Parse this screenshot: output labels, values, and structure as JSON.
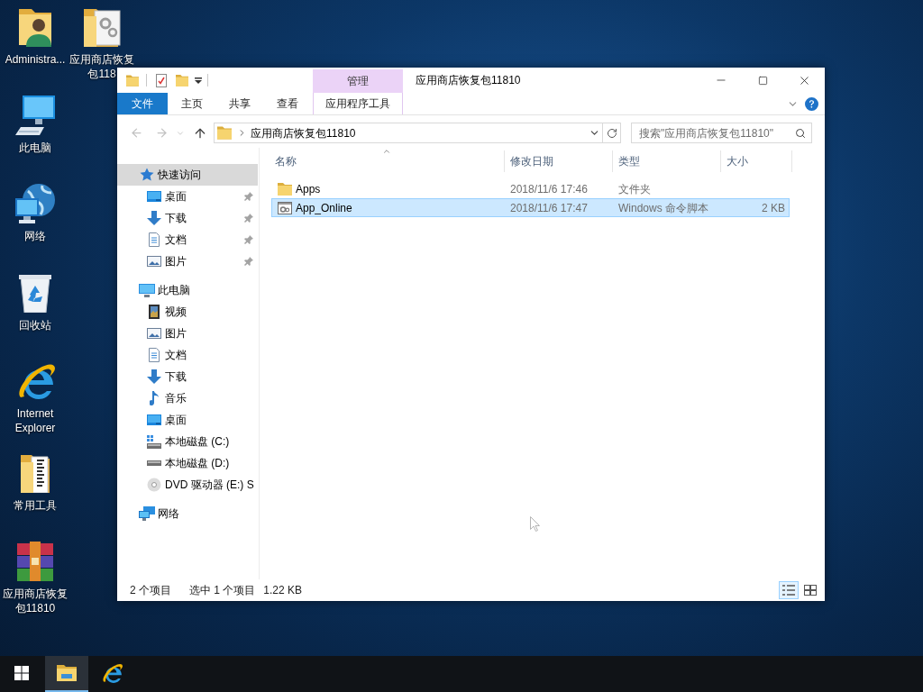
{
  "desktop": {
    "icons": [
      {
        "kind": "user-folder",
        "label": "Administra..."
      },
      {
        "kind": "package-folder",
        "label": "应用商店恢复包118"
      },
      {
        "kind": "computer",
        "label": "此电脑"
      },
      {
        "kind": "network",
        "label": "网络"
      },
      {
        "kind": "recycle-bin",
        "label": "回收站"
      },
      {
        "kind": "browser",
        "label": "Internet Explorer"
      },
      {
        "kind": "tools-folder",
        "label": "常用工具"
      },
      {
        "kind": "archive",
        "label": "应用商店恢复包11810"
      }
    ]
  },
  "window": {
    "title": "应用商店恢复包11810",
    "contextual_group": "管理",
    "ribbon_tabs": [
      {
        "kind": "file",
        "label": "文件"
      },
      {
        "kind": "tab",
        "label": "主页"
      },
      {
        "kind": "tab",
        "label": "共享"
      },
      {
        "kind": "tab",
        "label": "查看"
      },
      {
        "kind": "contextual",
        "label": "应用程序工具"
      }
    ],
    "address": {
      "path": [
        "应用商店恢复包11810"
      ]
    },
    "search": {
      "placeholder": "搜索\"应用商店恢复包11810\""
    },
    "navigation": [
      {
        "kind": "quick-access",
        "label": "快速访问",
        "selected": true,
        "children": [
          {
            "kind": "desktop",
            "label": "桌面",
            "selected": false,
            "pinned": true
          },
          {
            "kind": "downloads",
            "label": "下载",
            "selected": false,
            "pinned": true
          },
          {
            "kind": "documents",
            "label": "文档",
            "selected": false,
            "pinned": true
          },
          {
            "kind": "pictures",
            "label": "图片",
            "selected": false,
            "pinned": true
          }
        ]
      },
      {
        "kind": "pc",
        "label": "此电脑",
        "selected": false,
        "children": [
          {
            "kind": "videos",
            "label": "视频",
            "selected": false
          },
          {
            "kind": "pictures",
            "label": "图片",
            "selected": false
          },
          {
            "kind": "documents",
            "label": "文档",
            "selected": false
          },
          {
            "kind": "downloads",
            "label": "下载",
            "selected": false
          },
          {
            "kind": "music",
            "label": "音乐",
            "selected": false
          },
          {
            "kind": "desktop",
            "label": "桌面",
            "selected": false
          },
          {
            "kind": "system-disk",
            "label": "本地磁盘 (C:)",
            "selected": false
          },
          {
            "kind": "disk",
            "label": "本地磁盘 (D:)",
            "selected": false
          },
          {
            "kind": "dvd",
            "label": "DVD 驱动器 (E:) S",
            "selected": false
          }
        ]
      },
      {
        "kind": "network",
        "label": "网络",
        "selected": false
      }
    ],
    "file_list": {
      "columns": [
        {
          "label": "名称",
          "sorted": true
        },
        {
          "label": "修改日期",
          "sorted": false
        },
        {
          "label": "类型",
          "sorted": false
        },
        {
          "label": "大小",
          "sorted": false
        }
      ],
      "rows": [
        {
          "kind": "folder",
          "name": "Apps",
          "modified": "2018/11/6 17:46",
          "type": "文件夹",
          "selected": false
        },
        {
          "kind": "script",
          "name": "App_Online",
          "modified": "2018/11/6 17:47",
          "type": "Windows 命令脚本",
          "size": "2 KB",
          "selected": true
        }
      ]
    },
    "status_bar": {
      "item_count": "2 个项目",
      "selection": "选中 1 个项目",
      "selection_size": "1.22 KB",
      "view_buttons": [
        {
          "kind": "details",
          "selected": true
        },
        {
          "kind": "large-icons",
          "selected": false
        }
      ]
    }
  },
  "taskbar": {
    "buttons": [
      {
        "kind": "start",
        "active": false
      },
      {
        "kind": "file-explorer",
        "active": true
      },
      {
        "kind": "browser",
        "active": false
      }
    ]
  }
}
